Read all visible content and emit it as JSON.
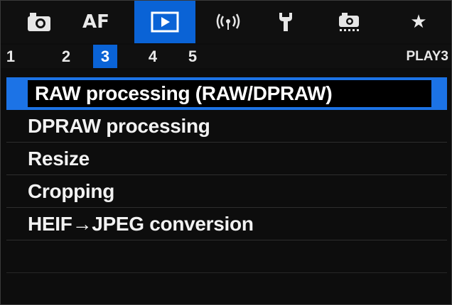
{
  "tabs": [
    {
      "name": "tab-shooting",
      "icon": "camera-icon",
      "glyph": ""
    },
    {
      "name": "tab-af",
      "icon": "",
      "glyph": "AF"
    },
    {
      "name": "tab-playback",
      "icon": "play-icon",
      "glyph": ""
    },
    {
      "name": "tab-wireless",
      "icon": "wireless-icon",
      "glyph": "((·))"
    },
    {
      "name": "tab-setup",
      "icon": "wrench-icon",
      "glyph": ""
    },
    {
      "name": "tab-custom",
      "icon": "custom-camera-icon",
      "glyph": ""
    },
    {
      "name": "tab-mymenu",
      "icon": "star-icon",
      "glyph": "★"
    }
  ],
  "active_tab_index": 2,
  "subtabs": [
    "1",
    "2",
    "3",
    "4",
    "5"
  ],
  "active_subtab_index": 2,
  "page_label": "PLAY3",
  "menu_items": [
    "RAW processing (RAW/DPRAW)",
    "DPRAW processing",
    "Resize",
    "Cropping",
    "HEIF→JPEG conversion"
  ],
  "selected_menu_index": 0,
  "colors": {
    "accent": "#0a63d6",
    "selection": "#1c73e6",
    "background": "#0d0d0d",
    "text": "#f2f2f2"
  }
}
